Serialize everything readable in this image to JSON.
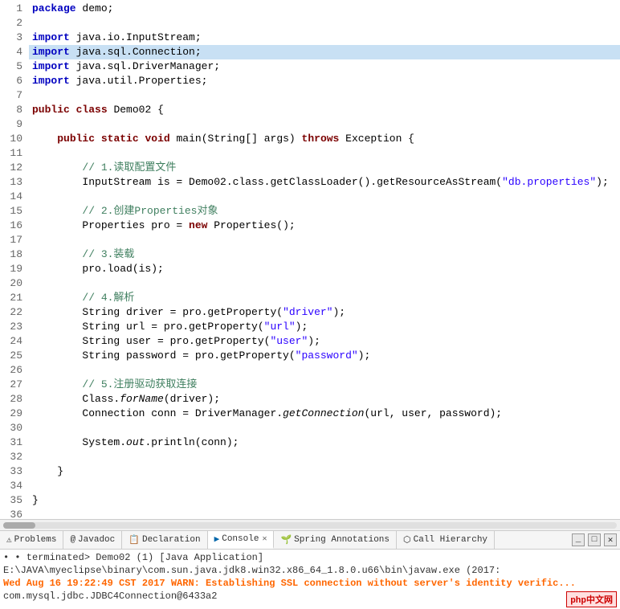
{
  "editor": {
    "lines": [
      {
        "num": 1,
        "content": "package_demo",
        "display": "package demo;",
        "highlighted": false
      },
      {
        "num": 2,
        "content": "",
        "display": "",
        "highlighted": false
      },
      {
        "num": 3,
        "content": "import_inputstream",
        "display": "import java.io.InputStream;",
        "highlighted": false
      },
      {
        "num": 4,
        "content": "import_connection",
        "display": "import java.sql.Connection;",
        "highlighted": true
      },
      {
        "num": 5,
        "content": "import_drivermanager",
        "display": "import java.sql.DriverManager;",
        "highlighted": false
      },
      {
        "num": 6,
        "content": "import_properties",
        "display": "import java.util.Properties;",
        "highlighted": false
      },
      {
        "num": 7,
        "content": "",
        "display": "",
        "highlighted": false
      },
      {
        "num": 8,
        "content": "class_decl",
        "display": "public class Demo02 {",
        "highlighted": false
      },
      {
        "num": 9,
        "content": "",
        "display": "",
        "highlighted": false
      },
      {
        "num": 10,
        "content": "main_method",
        "display": "    public static void main(String[] args) throws Exception {",
        "highlighted": false
      },
      {
        "num": 11,
        "content": "",
        "display": "",
        "highlighted": false
      },
      {
        "num": 12,
        "content": "comment1",
        "display": "        // 1.读取配置文件",
        "highlighted": false
      },
      {
        "num": 13,
        "content": "inputstream_line",
        "display": "        InputStream is = Demo02.class.getClassLoader().getResourceAsStream(\"db.properties\");",
        "highlighted": false
      },
      {
        "num": 14,
        "content": "",
        "display": "",
        "highlighted": false
      },
      {
        "num": 15,
        "content": "comment2",
        "display": "        // 2.创建Properties对象",
        "highlighted": false
      },
      {
        "num": 16,
        "content": "properties_line",
        "display": "        Properties pro = new Properties();",
        "highlighted": false
      },
      {
        "num": 17,
        "content": "",
        "display": "",
        "highlighted": false
      },
      {
        "num": 18,
        "content": "comment3",
        "display": "        // 3.装载",
        "highlighted": false
      },
      {
        "num": 19,
        "content": "proload_line",
        "display": "        pro.load(is);",
        "highlighted": false
      },
      {
        "num": 20,
        "content": "",
        "display": "",
        "highlighted": false
      },
      {
        "num": 21,
        "content": "comment4",
        "display": "        // 4.解析",
        "highlighted": false
      },
      {
        "num": 22,
        "content": "driver_line",
        "display": "        String driver = pro.getProperty(\"driver\");",
        "highlighted": false
      },
      {
        "num": 23,
        "content": "url_line",
        "display": "        String url = pro.getProperty(\"url\");",
        "highlighted": false
      },
      {
        "num": 24,
        "content": "user_line",
        "display": "        String user = pro.getProperty(\"user\");",
        "highlighted": false
      },
      {
        "num": 25,
        "content": "password_line",
        "display": "        String password = pro.getProperty(\"password\");",
        "highlighted": false
      },
      {
        "num": 26,
        "content": "",
        "display": "",
        "highlighted": false
      },
      {
        "num": 27,
        "content": "comment5",
        "display": "        // 5.注册驱动获取连接",
        "highlighted": false
      },
      {
        "num": 28,
        "content": "forname_line",
        "display": "        Class.forName(driver);",
        "highlighted": false
      },
      {
        "num": 29,
        "content": "connection_line",
        "display": "        Connection conn = DriverManager.getConnection(url, user, password);",
        "highlighted": false
      },
      {
        "num": 30,
        "content": "",
        "display": "",
        "highlighted": false
      },
      {
        "num": 31,
        "content": "println_line",
        "display": "        System.out.println(conn);",
        "highlighted": false
      },
      {
        "num": 32,
        "content": "",
        "display": "",
        "highlighted": false
      },
      {
        "num": 33,
        "content": "close_brace1",
        "display": "    }",
        "highlighted": false
      },
      {
        "num": 34,
        "content": "",
        "display": "",
        "highlighted": false
      },
      {
        "num": 35,
        "content": "close_brace2",
        "display": "}",
        "highlighted": false
      },
      {
        "num": 36,
        "content": "",
        "display": "",
        "highlighted": false
      }
    ]
  },
  "tabs": {
    "items": [
      {
        "label": "Problems",
        "icon": "⚠",
        "active": false,
        "closable": false
      },
      {
        "label": "Javadoc",
        "icon": "@",
        "active": false,
        "closable": false
      },
      {
        "label": "Declaration",
        "icon": "📄",
        "active": false,
        "closable": false
      },
      {
        "label": "Console",
        "icon": "▶",
        "active": true,
        "closable": true
      },
      {
        "label": "Spring Annotations",
        "icon": "🌱",
        "active": false,
        "closable": false
      },
      {
        "label": "Call Hierarchy",
        "icon": "⬡",
        "active": false,
        "closable": false
      }
    ],
    "controls": [
      "minimize",
      "maximize",
      "close"
    ]
  },
  "console": {
    "line1": "• terminated> Demo02 (1) [Java Application] E:\\JAVA\\myeclipse\\binary\\com.sun.java.jdk8.win32.x86_64_1.8.0.u66\\bin\\javaw.exe (2017:",
    "line2": "Wed Aug 16 19:22:49 CST 2017 WARN: Establishing SSL connection without server's identity verific...",
    "line3": "com.mysql.jdbc.JDBC4Connection@6433a2"
  },
  "watermark": "php中文网"
}
